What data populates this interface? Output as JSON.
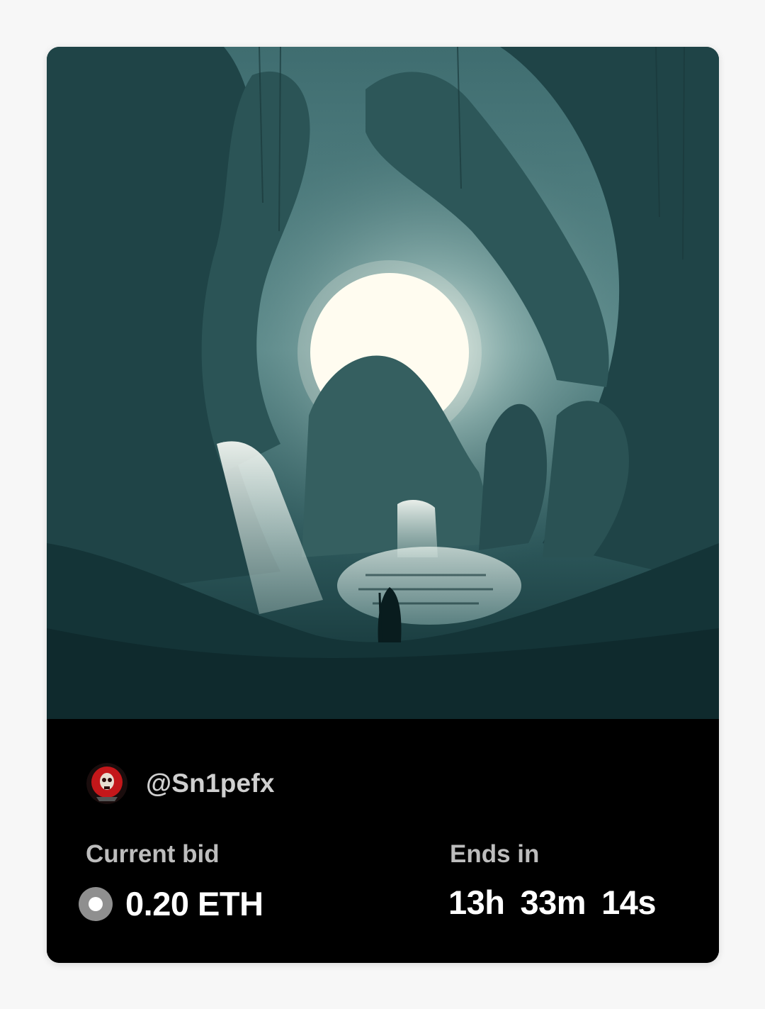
{
  "auction_card": {
    "artwork": {
      "icon": "nft-artwork-image",
      "colors": {
        "fog": "#2e5a5c",
        "deep": "#123236",
        "moon": "#fffdf0"
      }
    },
    "creator": {
      "handle": "@Sn1pefx",
      "avatar_icon": "skull-avatar-icon",
      "avatar_color": "#c4171a"
    },
    "current_bid": {
      "label": "Current bid",
      "value": "0.20 ETH",
      "currency_icon": "eth-coin-icon"
    },
    "ends_in": {
      "label": "Ends in",
      "hours": "13h",
      "minutes": "33m",
      "seconds": "14s"
    }
  }
}
